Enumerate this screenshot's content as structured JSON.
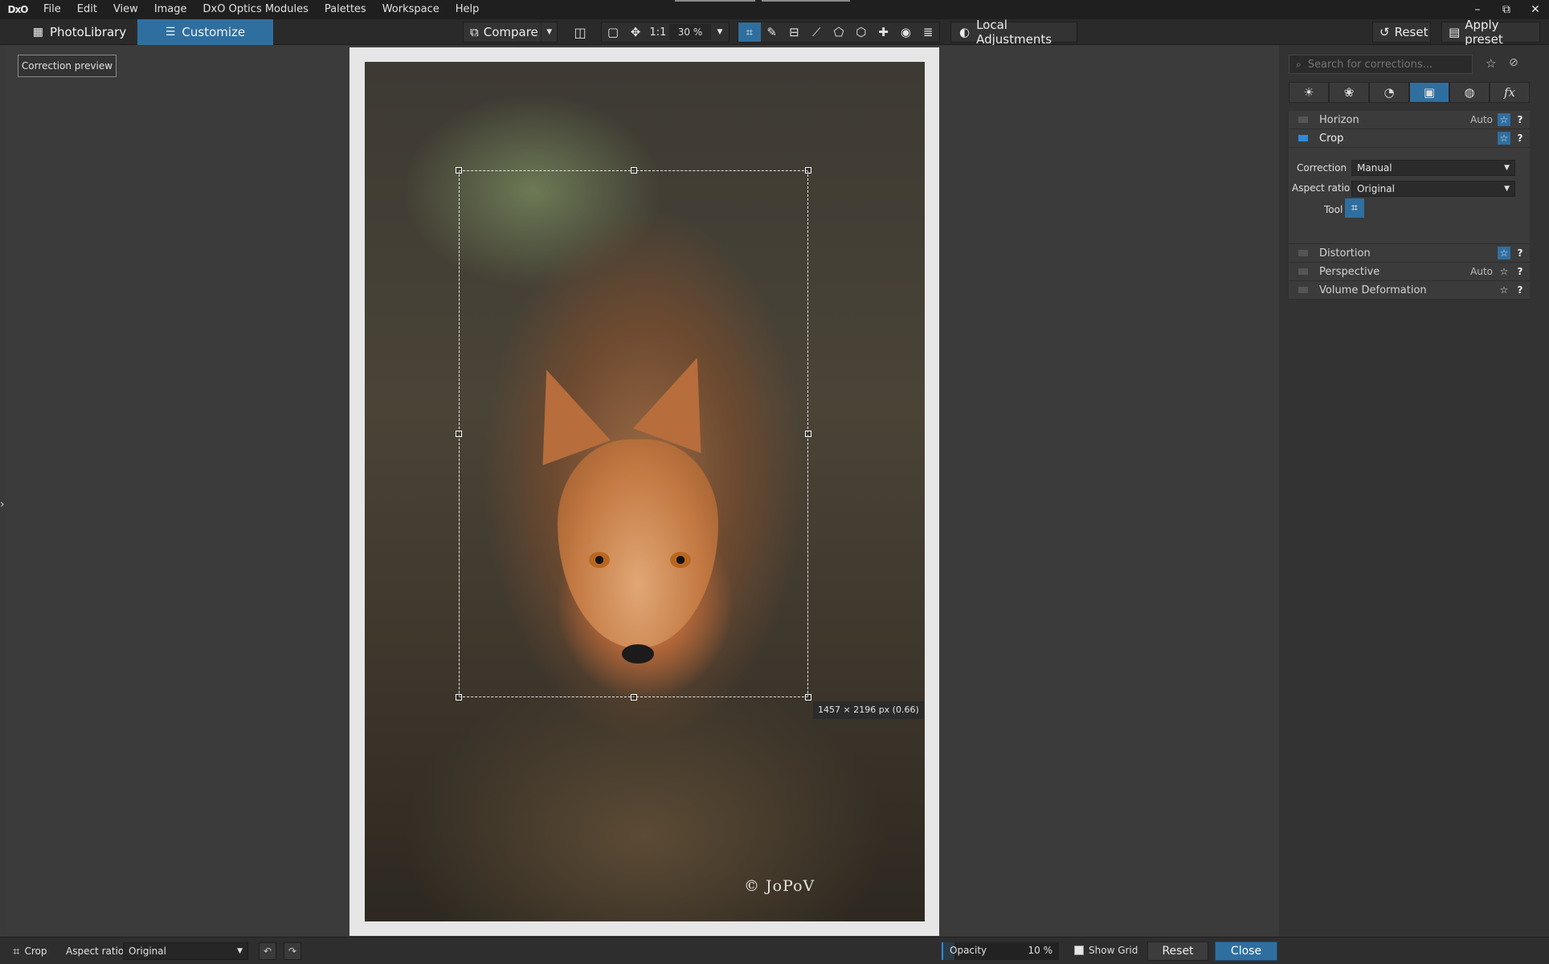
{
  "app": {
    "logo": "DxO"
  },
  "menu": [
    "File",
    "Edit",
    "View",
    "Image",
    "DxO Optics Modules",
    "Palettes",
    "Workspace",
    "Help"
  ],
  "window_controls": {
    "minimize": "–",
    "restore": "⧉",
    "close": "✕"
  },
  "tabs": {
    "photolibrary": "PhotoLibrary",
    "customize": "Customize",
    "active": "customize"
  },
  "toolbar": {
    "compare_label": "Compare",
    "zoom_one_to_one": "1:1",
    "zoom_value": "30 %",
    "local_adjustments_label": "Local Adjustments",
    "reset_label": "Reset",
    "apply_preset_label": "Apply preset",
    "active_tool": "crop-tool",
    "accent_color": "#2f6f9f"
  },
  "left_panel": {
    "correction_preview_label": "Correction preview"
  },
  "viewer": {
    "crop_size_label": "1457 × 2196 px (0.66)",
    "watermark": "© JoPoV"
  },
  "right_panel": {
    "search_placeholder": "Search for corrections...",
    "palette_tabs": [
      "light-icon",
      "color-icon",
      "detail-icon",
      "geometry-icon",
      "local-icon",
      "effects-icon"
    ],
    "active_palette": "geometry-icon",
    "corrections": {
      "horizon": {
        "name": "Horizon",
        "auto": "Auto",
        "help": "?"
      },
      "crop": {
        "name": "Crop",
        "help": "?",
        "correction_label": "Correction",
        "correction_value": "Manual",
        "aspect_label": "Aspect ratio",
        "aspect_value": "Original",
        "tool_label": "Tool"
      },
      "distortion": {
        "name": "Distortion",
        "help": "?"
      },
      "perspective": {
        "name": "Perspective",
        "auto": "Auto",
        "help": "?"
      },
      "volume": {
        "name": "Volume Deformation",
        "help": "?"
      }
    }
  },
  "bottom_bar": {
    "crop_label": "Crop",
    "aspect_label": "Aspect ratio",
    "aspect_value": "Original",
    "opacity_label": "Opacity",
    "opacity_value": "10 %",
    "opacity_fraction": 0.1,
    "show_grid_label": "Show Grid",
    "show_grid_checked": false,
    "reset_label": "Reset",
    "close_label": "Close"
  }
}
